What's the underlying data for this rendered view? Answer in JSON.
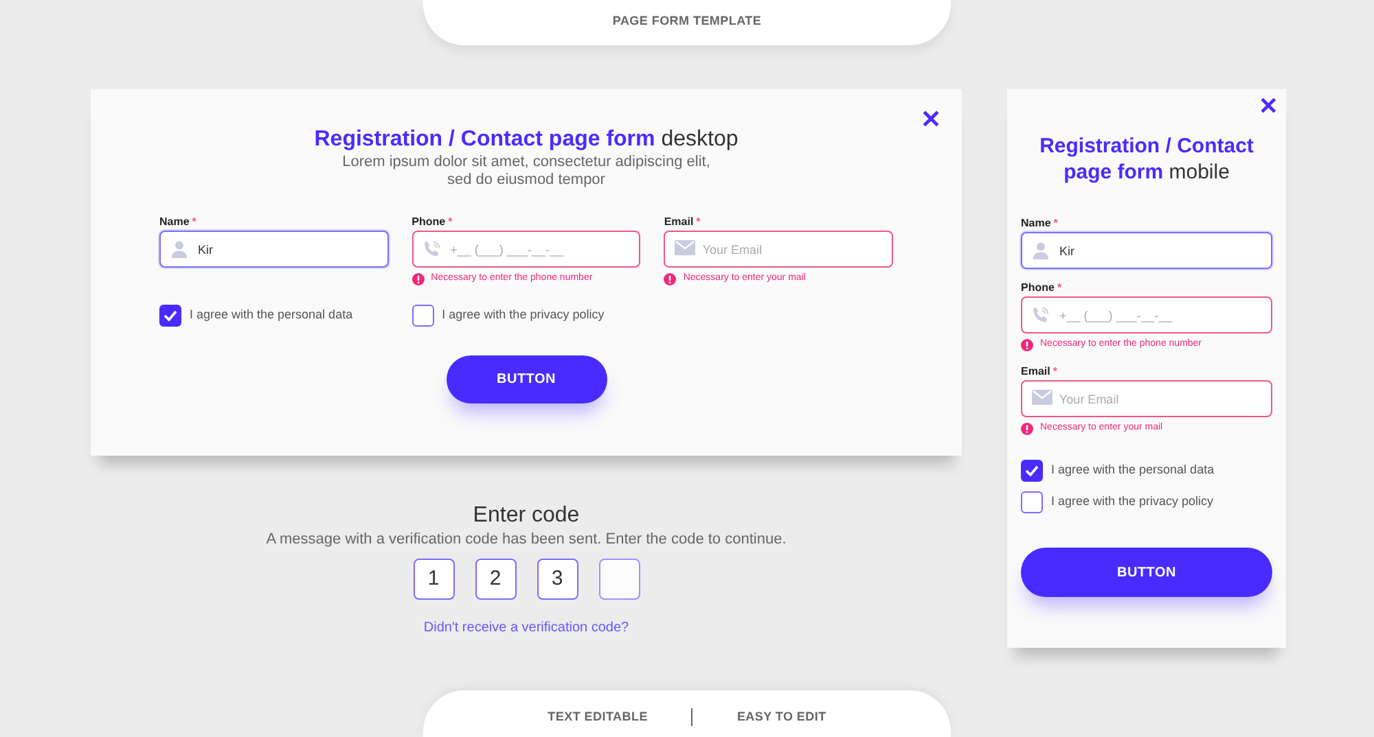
{
  "header_tab": {
    "label": "PAGE FORM TEMPLATE"
  },
  "forms": [
    {
      "kind": "desktop",
      "close": "✕",
      "title": "**Registration / Contact page form** desktop",
      "subtitle": "Lorem ipsum dolor sit amet, consectetur adipiscing elit,\nsed do eiusmod tempor",
      "fields": [
        {
          "kind": "name",
          "label": "Name",
          "required_mark": "*",
          "focused": true,
          "invalid": false,
          "value": "Kir"
        },
        {
          "kind": "phone",
          "label": "Phone",
          "required_mark": "*",
          "focused": false,
          "invalid": true,
          "placeholder": "+__ (___) ___-__-__",
          "error": "Necessary to enter the phone number"
        },
        {
          "kind": "email",
          "label": "Email",
          "required_mark": "*",
          "focused": false,
          "invalid": true,
          "placeholder": "Your Email",
          "error": "Necessary to enter your mail"
        }
      ],
      "checkboxes": [
        {
          "label": "I agree with the personal data",
          "checked": true
        },
        {
          "label": "I agree with the privacy policy",
          "checked": false
        }
      ],
      "button": "BUTTON"
    },
    {
      "kind": "mobile",
      "close": "✕",
      "title": "**Registration / Contact page form** mobile",
      "fields": [
        {
          "kind": "name",
          "label": "Name",
          "required_mark": "*",
          "focused": true,
          "invalid": false,
          "value": "Kir"
        },
        {
          "kind": "phone",
          "label": "Phone",
          "required_mark": "*",
          "focused": false,
          "invalid": true,
          "placeholder": "+__ (___) ___-__-__",
          "error": "Necessary to enter the phone number"
        },
        {
          "kind": "email",
          "label": "Email",
          "required_mark": "*",
          "focused": false,
          "invalid": true,
          "placeholder": "Your Email",
          "error": "Necessary to enter your mail"
        }
      ],
      "checkboxes": [
        {
          "label": "I agree with the personal data",
          "checked": true
        },
        {
          "label": "I agree with the privacy policy",
          "checked": false
        }
      ],
      "button": "BUTTON"
    }
  ],
  "verification": {
    "title": "Enter code",
    "message": "A message with a verification code has been sent. Enter the code to continue.",
    "code_boxes": [
      {
        "filled": true,
        "digit": "1"
      },
      {
        "filled": true,
        "digit": "2"
      },
      {
        "filled": true,
        "digit": "3"
      },
      {
        "filled": false
      }
    ],
    "link": "Didn't receive a verification code?"
  },
  "footer_tab": {
    "items": [
      "TEXT EDITABLE",
      "EASY TO EDIT"
    ]
  }
}
